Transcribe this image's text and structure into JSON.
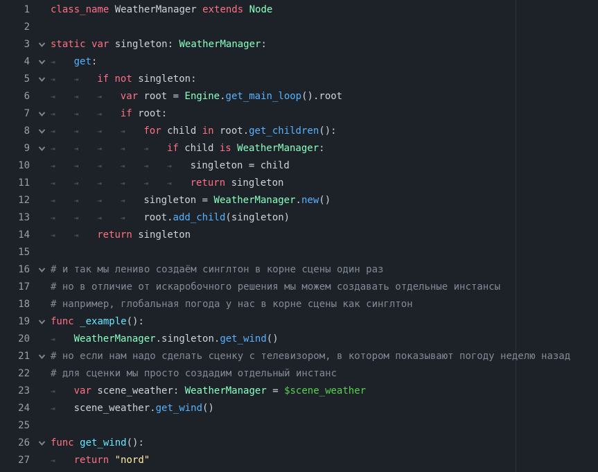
{
  "editor": {
    "lines": [
      {
        "num": "1",
        "indent": 0,
        "fold": false,
        "tokens": [
          {
            "t": "class_name",
            "c": "kw"
          },
          {
            "t": " WeatherManager ",
            "c": "pl"
          },
          {
            "t": "extends",
            "c": "kw"
          },
          {
            "t": " Node",
            "c": "ty"
          }
        ]
      },
      {
        "num": "2",
        "indent": 0,
        "fold": false,
        "tokens": []
      },
      {
        "num": "3",
        "indent": 0,
        "fold": true,
        "tokens": [
          {
            "t": "static",
            "c": "kw"
          },
          {
            "t": " ",
            "c": "pl"
          },
          {
            "t": "var",
            "c": "kw"
          },
          {
            "t": " singleton: ",
            "c": "pl"
          },
          {
            "t": "WeatherManager",
            "c": "ty"
          },
          {
            "t": ":",
            "c": "pl"
          }
        ]
      },
      {
        "num": "4",
        "indent": 1,
        "fold": true,
        "tokens": [
          {
            "t": "get",
            "c": "fn"
          },
          {
            "t": ":",
            "c": "pl"
          }
        ]
      },
      {
        "num": "5",
        "indent": 2,
        "fold": true,
        "tokens": [
          {
            "t": "if",
            "c": "kw"
          },
          {
            "t": " ",
            "c": "pl"
          },
          {
            "t": "not",
            "c": "kw"
          },
          {
            "t": " singleton:",
            "c": "pl"
          }
        ]
      },
      {
        "num": "6",
        "indent": 3,
        "fold": false,
        "tokens": [
          {
            "t": "var",
            "c": "kw"
          },
          {
            "t": " root = ",
            "c": "pl"
          },
          {
            "t": "Engine",
            "c": "ty"
          },
          {
            "t": ".",
            "c": "pl"
          },
          {
            "t": "get_main_loop",
            "c": "fn"
          },
          {
            "t": "().root",
            "c": "pl"
          }
        ]
      },
      {
        "num": "7",
        "indent": 3,
        "fold": true,
        "tokens": [
          {
            "t": "if",
            "c": "kw"
          },
          {
            "t": " root:",
            "c": "pl"
          }
        ]
      },
      {
        "num": "8",
        "indent": 4,
        "fold": true,
        "tokens": [
          {
            "t": "for",
            "c": "kw"
          },
          {
            "t": " child ",
            "c": "pl"
          },
          {
            "t": "in",
            "c": "kw"
          },
          {
            "t": " root.",
            "c": "pl"
          },
          {
            "t": "get_children",
            "c": "fn"
          },
          {
            "t": "():",
            "c": "pl"
          }
        ]
      },
      {
        "num": "9",
        "indent": 5,
        "fold": true,
        "tokens": [
          {
            "t": "if",
            "c": "kw"
          },
          {
            "t": " child ",
            "c": "pl"
          },
          {
            "t": "is",
            "c": "kw"
          },
          {
            "t": " ",
            "c": "pl"
          },
          {
            "t": "WeatherManager",
            "c": "ty"
          },
          {
            "t": ":",
            "c": "pl"
          }
        ]
      },
      {
        "num": "10",
        "indent": 6,
        "fold": false,
        "tokens": [
          {
            "t": "singleton = child",
            "c": "pl"
          }
        ]
      },
      {
        "num": "11",
        "indent": 6,
        "fold": false,
        "tokens": [
          {
            "t": "return",
            "c": "kw"
          },
          {
            "t": " singleton",
            "c": "pl"
          }
        ]
      },
      {
        "num": "12",
        "indent": 4,
        "fold": false,
        "tokens": [
          {
            "t": "singleton = ",
            "c": "pl"
          },
          {
            "t": "WeatherManager",
            "c": "ty"
          },
          {
            "t": ".",
            "c": "pl"
          },
          {
            "t": "new",
            "c": "fn"
          },
          {
            "t": "()",
            "c": "pl"
          }
        ]
      },
      {
        "num": "13",
        "indent": 4,
        "fold": false,
        "tokens": [
          {
            "t": "root.",
            "c": "pl"
          },
          {
            "t": "add_child",
            "c": "fn"
          },
          {
            "t": "(singleton)",
            "c": "pl"
          }
        ]
      },
      {
        "num": "14",
        "indent": 2,
        "fold": false,
        "tokens": [
          {
            "t": "return",
            "c": "kw"
          },
          {
            "t": " singleton",
            "c": "pl"
          }
        ]
      },
      {
        "num": "15",
        "indent": 0,
        "fold": false,
        "tokens": []
      },
      {
        "num": "16",
        "indent": 0,
        "fold": true,
        "tokens": [
          {
            "t": "# и так мы лениво создаём синглтон в корне сцены один раз",
            "c": "cm"
          }
        ]
      },
      {
        "num": "17",
        "indent": 0,
        "fold": false,
        "tokens": [
          {
            "t": "# но в отличие от искаробочного решения мы можем создавать отдельные инстансы",
            "c": "cm"
          }
        ]
      },
      {
        "num": "18",
        "indent": 0,
        "fold": false,
        "tokens": [
          {
            "t": "# например, глобальная погода у нас в корне сцены как синглтон",
            "c": "cm"
          }
        ]
      },
      {
        "num": "19",
        "indent": 0,
        "fold": true,
        "tokens": [
          {
            "t": "func",
            "c": "kw"
          },
          {
            "t": " ",
            "c": "pl"
          },
          {
            "t": "_example",
            "c": "ex"
          },
          {
            "t": "():",
            "c": "pl"
          }
        ]
      },
      {
        "num": "20",
        "indent": 1,
        "fold": false,
        "tokens": [
          {
            "t": "WeatherManager",
            "c": "ty"
          },
          {
            "t": ".singleton.",
            "c": "pl"
          },
          {
            "t": "get_wind",
            "c": "fn"
          },
          {
            "t": "()",
            "c": "pl"
          }
        ]
      },
      {
        "num": "21",
        "indent": 0,
        "fold": true,
        "tokens": [
          {
            "t": "# но если нам надо сделать сценку с телевизором, в котором показывают погоду неделю назад",
            "c": "cm"
          }
        ]
      },
      {
        "num": "22",
        "indent": 0,
        "fold": false,
        "tokens": [
          {
            "t": "# для сценки мы просто создадим отдельный инстанс",
            "c": "cm"
          }
        ]
      },
      {
        "num": "23",
        "indent": 1,
        "fold": false,
        "tokens": [
          {
            "t": "var",
            "c": "kw"
          },
          {
            "t": " scene_weather: ",
            "c": "pl"
          },
          {
            "t": "WeatherManager",
            "c": "ty"
          },
          {
            "t": " = ",
            "c": "pl"
          },
          {
            "t": "$scene_weather",
            "c": "nd"
          }
        ]
      },
      {
        "num": "24",
        "indent": 1,
        "fold": false,
        "tokens": [
          {
            "t": "scene_weather.",
            "c": "pl"
          },
          {
            "t": "get_wind",
            "c": "fn"
          },
          {
            "t": "()",
            "c": "pl"
          }
        ]
      },
      {
        "num": "25",
        "indent": 0,
        "fold": false,
        "tokens": []
      },
      {
        "num": "26",
        "indent": 0,
        "fold": true,
        "tokens": [
          {
            "t": "func",
            "c": "kw"
          },
          {
            "t": " ",
            "c": "pl"
          },
          {
            "t": "get_wind",
            "c": "ex"
          },
          {
            "t": "():",
            "c": "pl"
          }
        ]
      },
      {
        "num": "27",
        "indent": 1,
        "fold": false,
        "tokens": [
          {
            "t": "return",
            "c": "kw"
          },
          {
            "t": " ",
            "c": "pl"
          },
          {
            "t": "\"nord\"",
            "c": "st"
          }
        ]
      }
    ]
  }
}
